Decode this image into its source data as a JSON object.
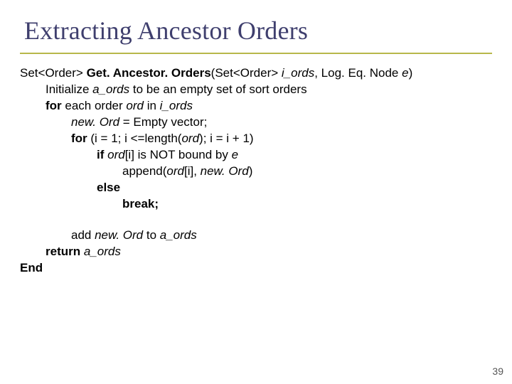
{
  "title": "Extracting Ancestor Orders",
  "page_num": "39",
  "code": {
    "l0": {
      "ret_type": "Set<Order> ",
      "fn": "Get. Ancestor. Orders",
      "open": "(",
      "param_type": "Set<Order> ",
      "param1": "i_ords",
      "sep": ", Log. Eq. Node ",
      "param2": "e",
      "close": ")"
    },
    "l1": {
      "a": "Initialize ",
      "b": "a_ords",
      "c": " to be an empty set of sort orders"
    },
    "l2": {
      "a": "for",
      "b": " each order ",
      "c": "ord",
      "d": " in ",
      "e": "i_ords"
    },
    "l3": {
      "a": "new. Ord",
      "b": " = Empty vector;"
    },
    "l4": {
      "a": "for",
      "b": " (i = 1; i <=length(",
      "c": "ord",
      "d": "); i = i + 1)"
    },
    "l5": {
      "a": "if ",
      "b": "ord",
      "c": "[i] is NOT bound by ",
      "d": "e"
    },
    "l6": {
      "a": "append(",
      "b": "ord",
      "c": "[i], ",
      "d": "new. Ord",
      "e": ")"
    },
    "l7": {
      "a": "else"
    },
    "l8": {
      "a": "break;"
    },
    "l9": {
      "a": "add ",
      "b": "new. Ord",
      "c": " to ",
      "d": "a_ords"
    },
    "l10": {
      "a": "return ",
      "b": "a_ords"
    },
    "l11": {
      "a": "End"
    }
  }
}
